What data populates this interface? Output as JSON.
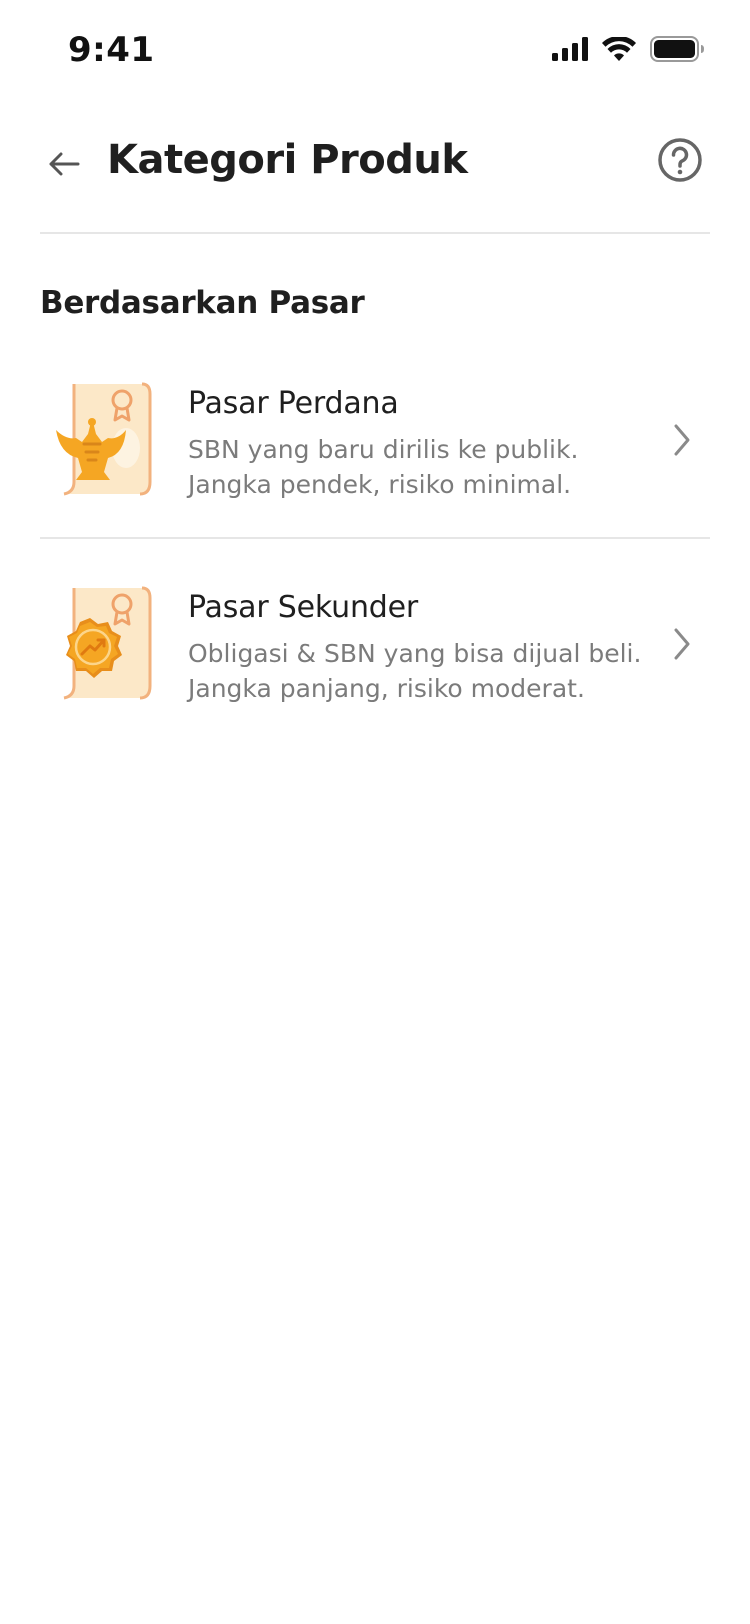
{
  "status_bar": {
    "time": "9:41"
  },
  "header": {
    "title": "Kategori Produk",
    "back_icon": "arrow-left-icon",
    "help_icon": "question-circle-icon"
  },
  "section": {
    "title": "Berdasarkan Pasar"
  },
  "items": [
    {
      "title": "Pasar Perdana",
      "desc_line1": "SBN yang baru dirilis ke publik.",
      "desc_line2": "Jangka pendek, risiko minimal.",
      "illustration": "certificate-garuda-icon"
    },
    {
      "title": "Pasar Sekunder",
      "desc_line1": "Obligasi & SBN yang bisa dijual beli.",
      "desc_line2": "Jangka panjang, risiko moderat.",
      "illustration": "certificate-growth-badge-icon"
    }
  ],
  "colors": {
    "accent_orange": "#F5A623",
    "divider": "#E6E6E6",
    "secondary_text": "#7B7B7B"
  }
}
